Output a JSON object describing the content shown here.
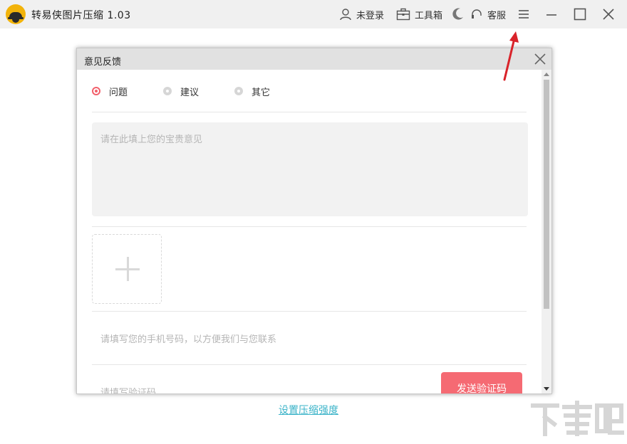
{
  "app": {
    "title": "转易侠图片压缩 1.03",
    "login_label": "未登录",
    "toolbox_label": "工具箱",
    "service_label": "客服"
  },
  "background": {
    "compress_link": "设置压缩强度"
  },
  "dialog": {
    "title": "意见反馈",
    "radio_options": [
      {
        "label": "问题",
        "selected": true
      },
      {
        "label": "建议",
        "selected": false
      },
      {
        "label": "其它",
        "selected": false
      }
    ],
    "feedback_placeholder": "请在此填上您的宝贵意见",
    "phone_placeholder": "请填写您的手机号码，以方便我们与您联系",
    "code_placeholder": "请填写验证码",
    "send_code_label": "发送验证码"
  },
  "watermark": "下载吧",
  "colors": {
    "accent": "#f56a73",
    "link": "#3ab3c8",
    "annotation_arrow": "#d9232a"
  }
}
